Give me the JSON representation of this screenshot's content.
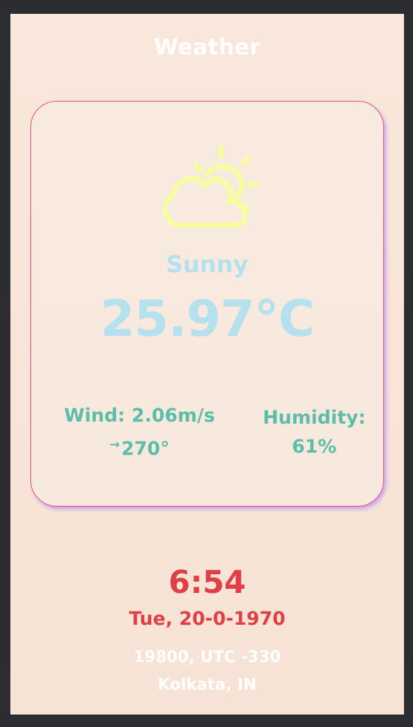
{
  "header": {
    "title": "Weather"
  },
  "weather": {
    "icon": "partly-sunny-icon",
    "condition": "Sunny",
    "temperature": "25.97°C",
    "wind_label": "Wind: 2.06m/s",
    "wind_direction": "270°",
    "humidity_label": "Humidity:",
    "humidity_value": "61%"
  },
  "time_info": {
    "time": "6:54",
    "date": "Tue, 20-0-1970",
    "timezone": "19800, UTC -330",
    "location": "Kolkata, IN"
  },
  "colors": {
    "background": "#f8e7da",
    "card_border": "#e34b74",
    "icon_yellow": "#f7fba4",
    "condition_blue": "#b5e0ee",
    "stats_green": "#5ebdaa",
    "time_red": "#df3f45",
    "white": "#ffffff",
    "card_shadow": "#a470ff"
  }
}
